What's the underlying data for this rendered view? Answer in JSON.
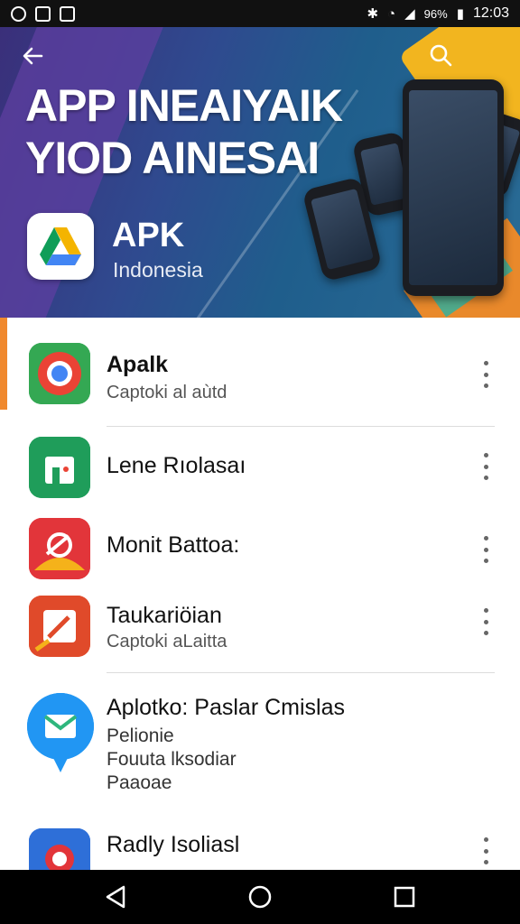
{
  "status_bar": {
    "signal_text": "96%",
    "time": "12:03"
  },
  "banner": {
    "title_line1": "APP INEAIYAIK",
    "title_line2": "YIOD AINESAI",
    "brand_name": "APK",
    "brand_sub": "Indonesia"
  },
  "apps": [
    {
      "title": "Apalk",
      "subtitle": "Captoki al aùtd"
    },
    {
      "title": "Lene Rıolasaı",
      "subtitle": ""
    },
    {
      "title": "Monit Battoa:",
      "subtitle": ""
    },
    {
      "title": "Taukariöian",
      "subtitle": "Captoki aLaitta"
    },
    {
      "title": "Aplotko: Paslar Cmislas",
      "lines": [
        "Pelionie",
        "Fouuta lksodiar",
        "Paaoae"
      ]
    },
    {
      "title": "Radly Isoliasl",
      "subtitle": ""
    }
  ],
  "colors": {
    "accent": "#f0892e",
    "banner_blue": "#2f4a8f",
    "banner_yellow": "#f2b51f"
  },
  "icons": {
    "back": "arrow-left",
    "search": "magnifier",
    "more": "vertical-dots",
    "nav_back": "triangle",
    "nav_home": "circle",
    "nav_recents": "square"
  }
}
